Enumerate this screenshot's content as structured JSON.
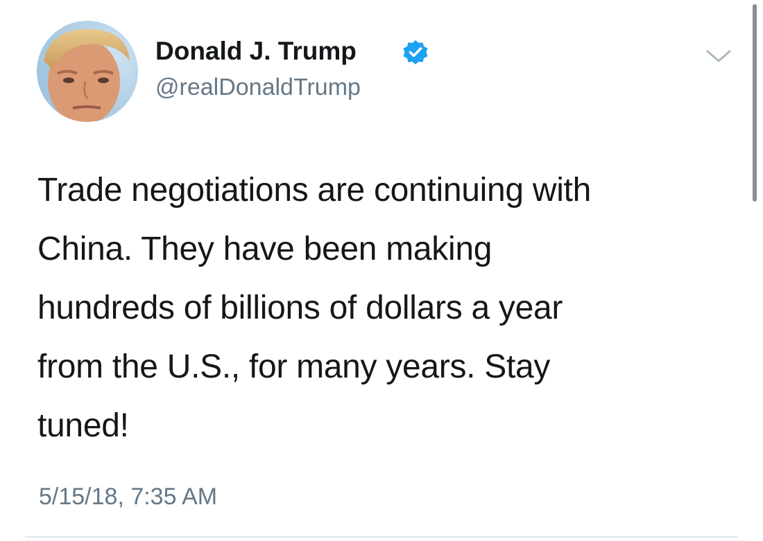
{
  "author": {
    "display_name": "Donald J. Trump",
    "handle": "@realDonaldTrump",
    "verified": true,
    "avatar": "profile-photo"
  },
  "tweet": {
    "lines": [
      "Trade negotiations are continuing with",
      "China. They have been making",
      "hundreds of billions of dollars a year",
      "from the U.S., for many years. Stay",
      "tuned!"
    ],
    "timestamp": "5/15/18, 7:35 AM"
  },
  "icons": {
    "verified": "verified-badge-icon",
    "more": "chevron-down-icon"
  },
  "colors": {
    "verified_blue": "#1da1f2",
    "secondary_text": "#657786",
    "primary_text": "#14171a",
    "divider": "#e1e8ed"
  }
}
